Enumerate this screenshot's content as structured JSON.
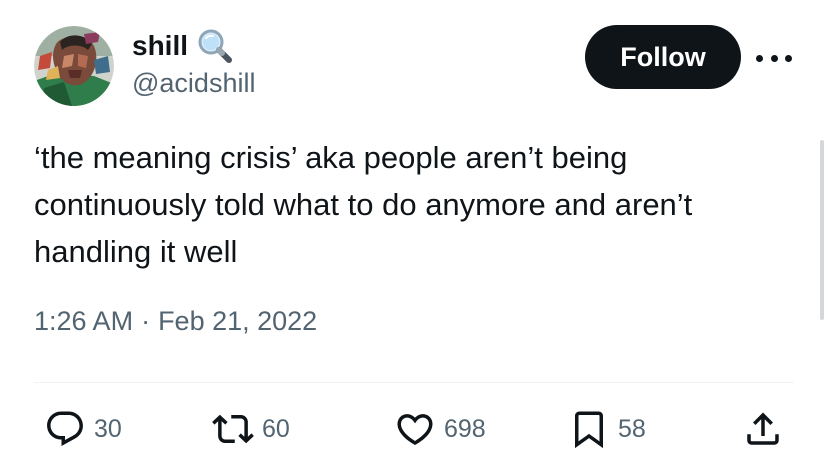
{
  "author": {
    "display_name": "shill",
    "name_emoji": "magnifying-glass-icon",
    "handle": "@acidshill"
  },
  "follow_button": {
    "label": "Follow"
  },
  "more_menu": {
    "icon": "more-icon"
  },
  "tweet": {
    "text": "‘the meaning crisis’ aka people aren’t being continuously told what to do anymore and aren’t handling it well",
    "time": "1:26 AM",
    "separator": "·",
    "date": "Feb 21, 2022"
  },
  "actions": {
    "replies": {
      "icon": "reply-icon",
      "count": "30"
    },
    "reposts": {
      "icon": "repost-icon",
      "count": "60"
    },
    "likes": {
      "icon": "heart-icon",
      "count": "698"
    },
    "bookmarks": {
      "icon": "bookmark-icon",
      "count": "58"
    },
    "share": {
      "icon": "share-icon"
    }
  },
  "colors": {
    "text_primary": "#0f1419",
    "text_secondary": "#536471",
    "follow_bg": "#0f1419",
    "follow_text": "#ffffff",
    "divider": "#eff3f4"
  }
}
